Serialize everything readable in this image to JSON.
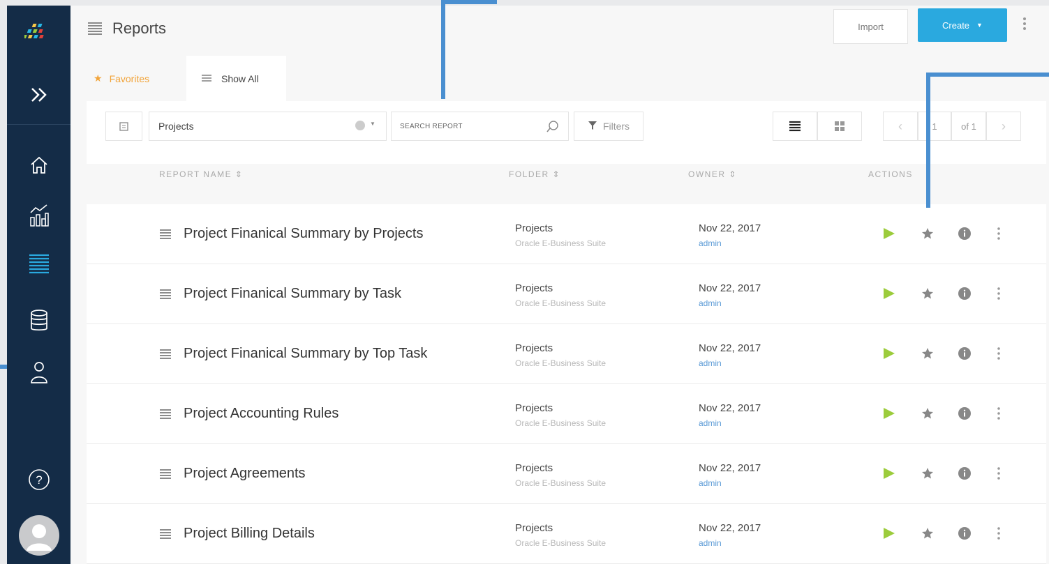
{
  "header": {
    "title": "Reports",
    "import_label": "Import",
    "create_label": "Create"
  },
  "tabs": {
    "favorites_label": "Favorites",
    "show_all_label": "Show All"
  },
  "toolbar": {
    "folder_value": "Projects",
    "search_placeholder": "SEARCH REPORT",
    "filters_label": "Filters",
    "page_current": "1",
    "page_total": "of 1"
  },
  "table": {
    "columns": [
      "REPORT NAME",
      "FOLDER",
      "OWNER",
      "ACTIONS"
    ],
    "rows": [
      {
        "name": "Project Finanical Summary by Projects",
        "folder": "Projects",
        "folder_sub": "Oracle E-Business Suite",
        "date": "Nov 22, 2017",
        "owner": "admin"
      },
      {
        "name": "Project Finanical Summary by Task",
        "folder": "Projects",
        "folder_sub": "Oracle E-Business Suite",
        "date": "Nov 22, 2017",
        "owner": "admin"
      },
      {
        "name": "Project Finanical Summary by Top Task",
        "folder": "Projects",
        "folder_sub": "Oracle E-Business Suite",
        "date": "Nov 22, 2017",
        "owner": "admin"
      },
      {
        "name": "Project Accounting Rules",
        "folder": "Projects",
        "folder_sub": "Oracle E-Business Suite",
        "date": "Nov 22, 2017",
        "owner": "admin"
      },
      {
        "name": "Project Agreements",
        "folder": "Projects",
        "folder_sub": "Oracle E-Business Suite",
        "date": "Nov 22, 2017",
        "owner": "admin"
      },
      {
        "name": "Project Billing Details",
        "folder": "Projects",
        "folder_sub": "Oracle E-Business Suite",
        "date": "Nov 22, 2017",
        "owner": "admin"
      }
    ]
  },
  "icons": {
    "sidebar": [
      "logo-icon",
      "expand-icon",
      "home-icon",
      "analytics-icon",
      "reports-icon",
      "database-icon",
      "user-icon",
      "help-icon",
      "avatar"
    ],
    "row_actions": [
      "play-icon",
      "star-icon",
      "info-icon",
      "kebab-icon"
    ]
  },
  "colors": {
    "sidebar_bg": "#142c47",
    "accent_blue": "#2aa9df",
    "favorite_orange": "#f2a43a",
    "play_green": "#9ccc3c",
    "owner_link": "#5a9ad6",
    "callout_line": "#4a8fd0"
  }
}
